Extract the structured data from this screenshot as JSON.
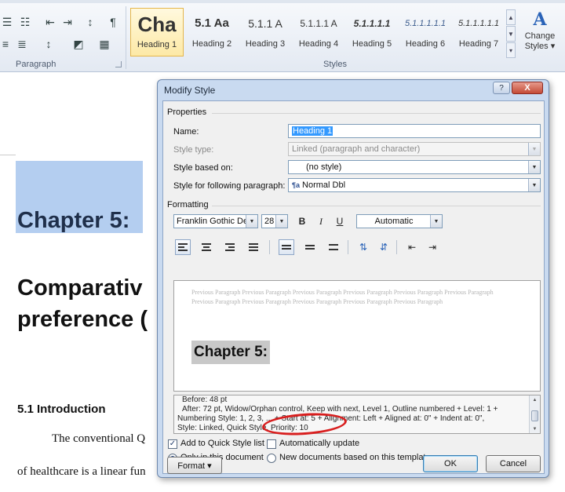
{
  "ribbon": {
    "paragraph_group_label": "Paragraph",
    "styles_group_label": "Styles",
    "paragraph_buttons": [
      {
        "name": "bullets-button",
        "icon": "bullets-icon",
        "glyph": "☰"
      },
      {
        "name": "multilevel-list-button",
        "icon": "multilevel-list-icon",
        "glyph": "☷"
      },
      {
        "name": "decrease-indent-button",
        "icon": "decrease-indent-icon",
        "glyph": "⇤"
      },
      {
        "name": "increase-indent-button",
        "icon": "increase-indent-icon",
        "glyph": "⇥"
      },
      {
        "name": "sort-button",
        "icon": "sort-icon",
        "glyph": "↕"
      },
      {
        "name": "show-marks-button",
        "icon": "pilcrow-icon",
        "glyph": "¶"
      },
      {
        "name": "align-left-button",
        "icon": "align-left-icon",
        "glyph": "≡"
      },
      {
        "name": "justify-button",
        "icon": "justify-icon",
        "glyph": "≣"
      },
      {
        "name": "line-spacing-button",
        "icon": "line-spacing-icon",
        "glyph": "↕"
      },
      {
        "name": "shading-button",
        "icon": "shading-icon",
        "glyph": "◩"
      },
      {
        "name": "borders-button",
        "icon": "borders-icon",
        "glyph": "▦"
      }
    ],
    "style_gallery": [
      {
        "preview": "Cha",
        "label": "Heading 1",
        "selected": true
      },
      {
        "preview": "5.1 Aa",
        "label": "Heading 2"
      },
      {
        "preview": "5.1.1 A",
        "label": "Heading 3"
      },
      {
        "preview": "5.1.1.1 A",
        "label": "Heading 4"
      },
      {
        "preview": "5.1.1.1.1",
        "label": "Heading 5"
      },
      {
        "preview": "5.1.1.1.1.1",
        "label": "Heading 6"
      },
      {
        "preview": "5.1.1.1.1.1",
        "label": "Heading 7"
      }
    ],
    "change_styles": {
      "icon": "change-styles-icon",
      "label_line1": "Change",
      "label_line2": "Styles ▾"
    }
  },
  "document": {
    "chapter_heading": "Chapter 5:",
    "title_line1": "Comparativ",
    "title_line2": "preference (",
    "section_heading": "5.1 Introduction",
    "para_line1": "The conventional Q",
    "para_line2": "of healthcare is a linear fun"
  },
  "dialog": {
    "title": "Modify Style",
    "help_label": "?",
    "close_label": "X",
    "properties_label": "Properties",
    "name_label": "Name:",
    "name_value": "Heading 1",
    "style_type_label": "Style type:",
    "style_type_value": "Linked (paragraph and character)",
    "based_on_label": "Style based on:",
    "based_on_value": "(no style)",
    "following_label": "Style for following paragraph:",
    "following_icon_glyph": "¶a",
    "following_value": "Normal Dbl",
    "formatting_label": "Formatting",
    "font_value": "Franklin Gothic Dem",
    "size_value": "28",
    "bold_label": "B",
    "italic_label": "I",
    "underline_label": "U",
    "color_value": "Automatic",
    "preview_para_line1": "Previous Paragraph Previous Paragraph Previous Paragraph Previous Paragraph Previous Paragraph Previous Paragraph",
    "preview_para_line2": "Previous Paragraph Previous Paragraph Previous Paragraph Previous Paragraph Previous Paragraph",
    "preview_heading": "Chapter 5:",
    "description_lines": [
      "Before:  48 pt",
      "After:  72 pt, Widow/Orphan control, Keep with next, Level 1, Outline numbered + Level: 1 +",
      "Numbering Style: 1, 2, 3, ... + Start at: 5 + Alignment: Left + Aligned at:  0\" + Indent at:  0\",",
      "Style: Linked, Quick Style, Priority: 10"
    ],
    "add_quick_style_label": "Add to Quick Style list",
    "add_quick_style_checked": true,
    "auto_update_label": "Automatically update",
    "auto_update_checked": false,
    "only_doc_label": "Only in this document",
    "new_docs_label": "New documents based on this template",
    "format_button": "Format ▾",
    "ok_button": "OK",
    "cancel_button": "Cancel"
  },
  "colors": {
    "highlight_annotation": "#d81e1e",
    "selection_blue": "#3399ff",
    "doc_selection": "#b4cef0",
    "dialog_frame": "#c9daf0"
  }
}
